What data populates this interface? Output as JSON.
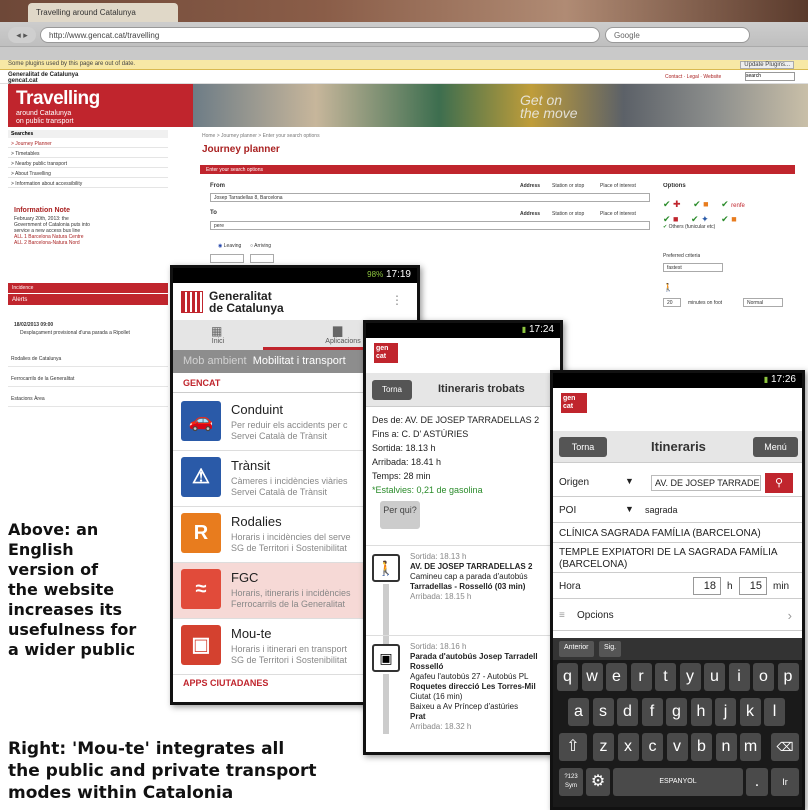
{
  "browser": {
    "tab_title": "Travelling around Catalunya",
    "url": "http://www.gencat.cat/travelling",
    "search_placeholder": "Google",
    "plugin_bar": "Some plugins used by this page are out of date.",
    "plugin_button": "Update Plugins...",
    "site_name": "Generalitat de Catalunya",
    "site_domain": "gencat.cat",
    "header_links": "Contact · Legal · Website",
    "header_search": "search"
  },
  "site": {
    "banner_title": "Travelling",
    "banner_sub1": "around Catalunya",
    "banner_sub2": "on public transport",
    "slogan_line1": "Get on",
    "slogan_line2": "the move",
    "crumbs": "Home > Journey planner > Enter your search options",
    "page_title": "Journey planner",
    "form_header": "Enter your search options",
    "from_label": "From",
    "from_value": "Josep Tarradellas 8, Barcelona",
    "to_label": "To",
    "to_value": "pere",
    "address_label": "Address",
    "station_label": "Station or stop",
    "poi_label": "Place of interest",
    "options_label": "Options",
    "leaving": "Leaving",
    "arriving": "Arriving",
    "others_label": "Others (funicular etc)",
    "preferred": "Preferred criteria",
    "fastest": "fastest",
    "minutes_label": "minutes on foot",
    "walk_value": "20",
    "normal": "Normal"
  },
  "sidebar": {
    "head": "Searches",
    "items": [
      "> Journey Planner",
      "> Timetables",
      "> Nearby public transport",
      "> About Travelling",
      "> Information about accessibility"
    ],
    "note_title": "Information Note",
    "note_text": "February 20th, 2013: the Government of Catalonia puts into service a new access bus line",
    "note_text2": "ALL 1 Barcelona Natura Centre",
    "note_text3": "ALL 2 Barcelona-Natura Nord",
    "incidence": "Incidence",
    "alerts": "Alerts",
    "alert_date": "18/02/2013 09:00",
    "alert_text": "Desplaçament provisional d'una parada a Ripollet",
    "links": [
      "Rodalies de Catalunya",
      "Ferrocarrils de la Generalitat",
      "Estacions Àrea"
    ]
  },
  "phone1": {
    "time": "17:19",
    "battery": "98%",
    "brand1": "Generalitat",
    "brand2": "de Catalunya",
    "tab_home": "Inici",
    "tab_apps": "Aplicacions",
    "crumb_a": "Mob ambient",
    "crumb_b": "Mobilitat i transport",
    "section": "GENCAT",
    "apps": [
      {
        "name": "Conduint",
        "desc": "Per reduir els accidents per c",
        "desc2": "Servei Català de Trànsit",
        "color": "#2a5aa8",
        "glyph": "🚗"
      },
      {
        "name": "Trànsit",
        "desc": "Càmeres i incidències viàries",
        "desc2": "Servei Català de Trànsit",
        "color": "#2a5aa8",
        "glyph": "⚠"
      },
      {
        "name": "Rodalies",
        "desc": "Horaris i incidències del serve",
        "desc2": "SG de Territori i Sostenibilitat",
        "color": "#e87c1e",
        "glyph": "R"
      },
      {
        "name": "FGC",
        "desc": "Horaris, itineraris i incidències",
        "desc2": "Ferrocarrils de la Generalitat",
        "color": "#e14b3a",
        "glyph": "≈"
      },
      {
        "name": "Mou-te",
        "desc": "Horaris i itinerari en transport",
        "desc2": "SG de Territori i Sostenibilitat",
        "color": "#d4412f",
        "glyph": "🚌"
      }
    ],
    "apps_section": "APPS CIUTADANES"
  },
  "phone2": {
    "time": "17:24",
    "logo": "gen cat",
    "back": "Torna",
    "title": "Itineraris trobats",
    "from": "Des de: AV. DE JOSEP TARRADELLAS 2",
    "to": "Fins a: C. D' ASTÚRIES",
    "depart": "Sortida: 18.13 h",
    "arrive": "Arribada: 18.41 h",
    "time_total": "Temps: 28 min",
    "savings": "*Estalvies: 0,21 de gasolina",
    "per": "Per qui?",
    "step1": [
      "Sortida: 18.13 h",
      "AV. DE JOSEP TARRADELLAS 2",
      "Camineu cap a parada d'autobús",
      "Tarradellas - Rosselló (03 min)",
      "Arribada: 18.15 h"
    ],
    "step2": [
      "Sortida: 18.16 h",
      "Parada d'autobús Josep Tarradell",
      "Rosselló",
      "Agafeu l'autobús 27 - Autobús PL",
      "Roquetes direcció Les Torres-Mil",
      "Ciutat (16 min)",
      "Baixeu a Av Príncep d'astúries",
      "Prat",
      "Arribada: 18.32 h"
    ]
  },
  "phone3": {
    "time": "17:26",
    "logo": "gen cat",
    "back": "Torna",
    "title": "Itineraris",
    "menu": "Menú",
    "origin_label": "Origen",
    "origin_value": "AV. DE JOSEP TARRADELLAS 2",
    "poi_label": "POI",
    "poi_value": "sagrada",
    "suggest1": "CLÍNICA SAGRADA FAMÍLIA (BARCELONA)",
    "suggest2a": "TEMPLE EXPIATORI DE LA SAGRADA FAMÍLIA",
    "suggest2b": "(BARCELONA)",
    "hour_label": "Hora",
    "hour": "18",
    "h": "h",
    "min_value": "15",
    "min": "min",
    "options": "Opcions",
    "prev": "Anterior",
    "next": "Sig.",
    "row1": [
      "q",
      "w",
      "e",
      "r",
      "t",
      "y",
      "u",
      "i",
      "o",
      "p"
    ],
    "row2": [
      "a",
      "s",
      "d",
      "f",
      "g",
      "h",
      "j",
      "k",
      "l"
    ],
    "row3": [
      "z",
      "x",
      "c",
      "v",
      "b",
      "n",
      "m"
    ],
    "sym": "?123 Sym",
    "space": "ESPANYOL",
    "enter": "Ir"
  },
  "captions": {
    "left": [
      "Above: an",
      "English",
      "version of",
      "the website",
      "increases its",
      "usefulness for",
      "a wider public"
    ],
    "right": [
      "Right: 'Mou-te' integrates all",
      "the public and private transport",
      "modes within Catalonia"
    ]
  }
}
